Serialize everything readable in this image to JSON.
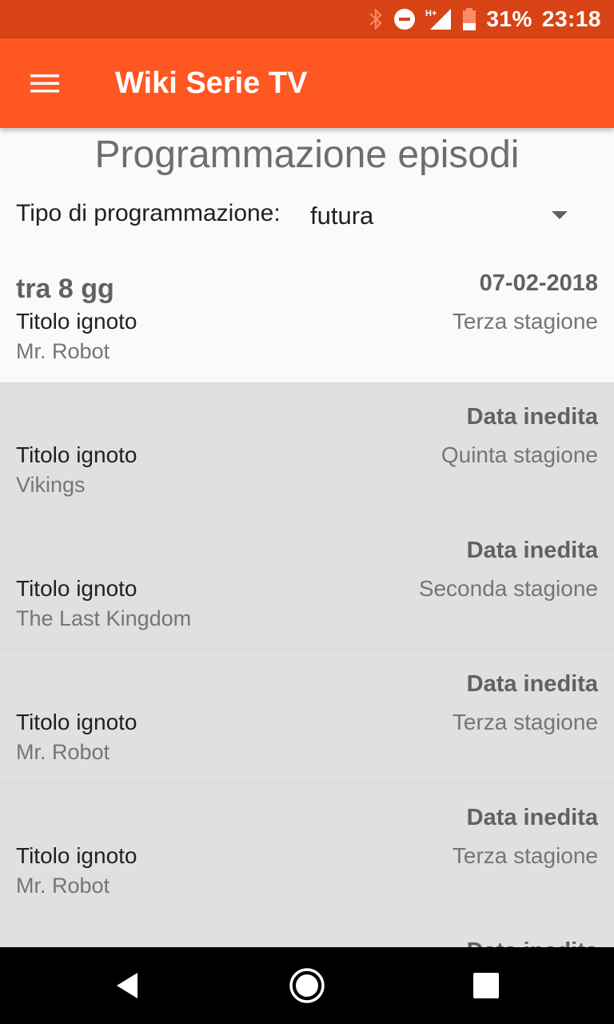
{
  "status_bar": {
    "icons": [
      "bluetooth-icon",
      "do-not-disturb-icon",
      "signal-hplus-icon",
      "battery-icon"
    ],
    "network_label": "H+",
    "battery": "31%",
    "time": "23:18"
  },
  "toolbar": {
    "menu_icon": "hamburger-menu-icon",
    "title": "Wiki Serie TV",
    "accent_color": "#ff5722",
    "status_color": "#d84315"
  },
  "page": {
    "title": "Programmazione episodi",
    "filter_label": "Tipo di programmazione:",
    "filter_value": "futura"
  },
  "episodes": [
    {
      "countdown": "tra 8 gg",
      "date": "07-02-2018",
      "title": "Titolo ignoto",
      "season": "Terza stagione",
      "series": "Mr. Robot"
    },
    {
      "countdown": "",
      "date": "Data inedita",
      "title": "Titolo ignoto",
      "season": "Quinta stagione",
      "series": "Vikings"
    },
    {
      "countdown": "",
      "date": "Data inedita",
      "title": "Titolo ignoto",
      "season": "Seconda stagione",
      "series": "The Last Kingdom"
    },
    {
      "countdown": "",
      "date": "Data inedita",
      "title": "Titolo ignoto",
      "season": "Terza stagione",
      "series": "Mr. Robot"
    },
    {
      "countdown": "",
      "date": "Data inedita",
      "title": "Titolo ignoto",
      "season": "Terza stagione",
      "series": "Mr. Robot"
    },
    {
      "countdown": "",
      "date": "Data inedita",
      "title": "",
      "season": "",
      "series": ""
    }
  ],
  "nav_bar": {
    "icons": [
      "back-icon",
      "home-icon",
      "recents-icon"
    ]
  }
}
